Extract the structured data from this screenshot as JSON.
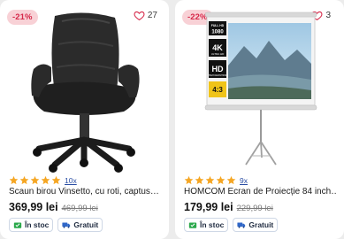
{
  "products": [
    {
      "discount": "-21%",
      "favorites": "27",
      "reviews": "10x",
      "rating": 5,
      "title": "Scaun birou Vinsetto, cu roti, captus…",
      "price": "369,99 lei",
      "old_price": "469,99 lei",
      "tags": {
        "stock": "În stoc",
        "shipping": "Gratuit"
      }
    },
    {
      "discount": "-22%",
      "favorites": "3",
      "reviews": "9x",
      "rating": 5,
      "title": "HOMCOM Ecran de Proiecție 84 inch…",
      "price": "179,99 lei",
      "old_price": "229,99 lei",
      "tags": {
        "stock": "În stoc",
        "shipping": "Gratuit"
      },
      "screen_labels": {
        "full_hd": "FULL HD",
        "res": "1080",
        "k": "4K",
        "ultra": "ULTRA HD",
        "hd": "HD",
        "hd_sub": "HIGH DEFINITION",
        "ratio": "4:3"
      }
    }
  ],
  "colors": {
    "star": "#f5a623",
    "badge_bg": "#f8d1d6",
    "badge_text": "#d6294a",
    "link": "#2a4ea4",
    "stock_icon": "#2aa84a",
    "shipping_icon": "#2f67c8"
  },
  "icons": {
    "favorite": "heart-icon",
    "rating": "star-icon",
    "stock": "stock-check-icon",
    "shipping": "delivery-truck-icon"
  }
}
